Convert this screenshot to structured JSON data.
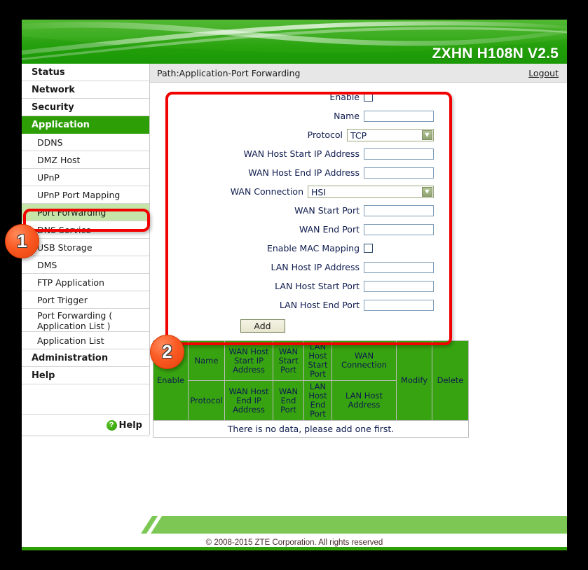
{
  "header": {
    "device_title": "ZXHN H108N V2.5"
  },
  "pathbar": {
    "path": "Path:Application-Port Forwarding",
    "logout": "Logout"
  },
  "sidebar": {
    "top_items": [
      {
        "label": "Status",
        "active": false
      },
      {
        "label": "Network",
        "active": false
      },
      {
        "label": "Security",
        "active": false
      },
      {
        "label": "Application",
        "active": true
      }
    ],
    "sub_items": [
      {
        "label": "DDNS",
        "selected": false
      },
      {
        "label": "DMZ Host",
        "selected": false
      },
      {
        "label": "UPnP",
        "selected": false
      },
      {
        "label": "UPnP Port Mapping",
        "selected": false
      },
      {
        "label": "Port Forwarding",
        "selected": true
      },
      {
        "label": "DNS Service",
        "selected": false
      },
      {
        "label": "USB Storage",
        "selected": false
      },
      {
        "label": "DMS",
        "selected": false
      },
      {
        "label": "FTP Application",
        "selected": false
      },
      {
        "label": "Port Trigger",
        "selected": false
      },
      {
        "label": "Port Forwarding ( Application List )",
        "selected": false
      },
      {
        "label": "Application List",
        "selected": false
      }
    ],
    "bottom_items": [
      {
        "label": "Administration"
      },
      {
        "label": "Help"
      }
    ],
    "help_link": "Help",
    "help_icon": "question-mark-icon"
  },
  "form": {
    "rows": [
      {
        "label": "Enable",
        "type": "checkbox",
        "value": "",
        "checked": false
      },
      {
        "label": "Name",
        "type": "text",
        "value": "",
        "placeholder": ""
      },
      {
        "label": "Protocol",
        "type": "select",
        "value": "TCP"
      },
      {
        "label": "WAN Host Start IP Address",
        "type": "text",
        "value": "",
        "placeholder": ""
      },
      {
        "label": "WAN Host End IP Address",
        "type": "text",
        "value": "",
        "placeholder": ""
      },
      {
        "label": "WAN Connection",
        "type": "select",
        "value": "HSI"
      },
      {
        "label": "WAN Start Port",
        "type": "text",
        "value": "",
        "placeholder": ""
      },
      {
        "label": "WAN End Port",
        "type": "text",
        "value": "",
        "placeholder": ""
      },
      {
        "label": "Enable MAC Mapping",
        "type": "checkbox",
        "value": "",
        "checked": false
      },
      {
        "label": "LAN Host IP Address",
        "type": "text",
        "value": "",
        "placeholder": ""
      },
      {
        "label": "LAN Host Start Port",
        "type": "text",
        "value": "",
        "placeholder": ""
      },
      {
        "label": "LAN Host End Port",
        "type": "text",
        "value": "",
        "placeholder": ""
      }
    ],
    "add_button": "Add"
  },
  "table": {
    "headers_row1": [
      "Enable",
      "Name",
      "WAN Host Start IP Address",
      "WAN Start Port",
      "LAN Host Start Port",
      "WAN Connection",
      "Modify",
      "Delete"
    ],
    "headers_row2": [
      "Protocol",
      "WAN Host End IP Address",
      "WAN End Port",
      "LAN Host End Port",
      "LAN Host Address"
    ],
    "empty_message": "There is no data, please add one first."
  },
  "footer": {
    "copyright": "© 2008-2015 ZTE Corporation. All rights reserved"
  },
  "annotations": {
    "badge1": "1",
    "badge2": "2"
  },
  "colors": {
    "brand_green": "#2e9e07",
    "table_green": "#37a310",
    "selected_green": "#c5e6a8",
    "annotation_red": "#f20000",
    "badge_orange": "#fa5a23"
  }
}
